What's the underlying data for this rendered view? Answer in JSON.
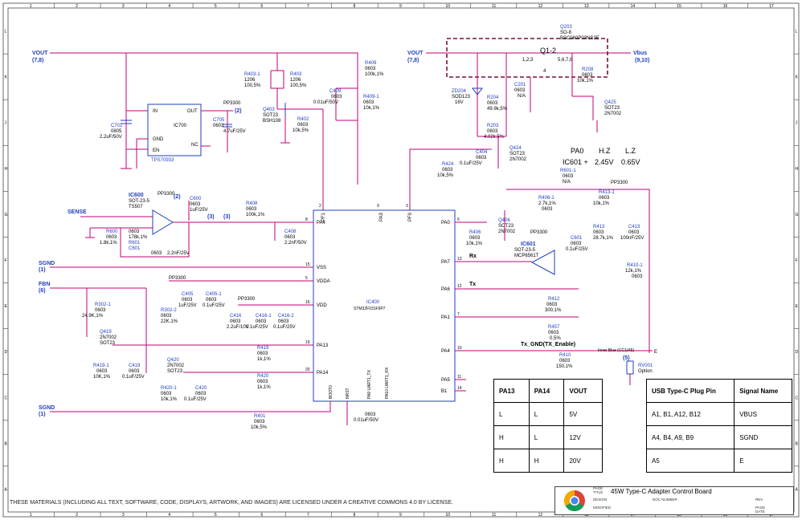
{
  "grid": {
    "columns": [
      "1",
      "2",
      "3",
      "4",
      "5",
      "6",
      "7",
      "8",
      "9",
      "10",
      "11",
      "12",
      "13",
      "14",
      "15",
      "16",
      "17"
    ],
    "rows": [
      "L",
      "K",
      "J",
      "H",
      "G",
      "F",
      "E",
      "D",
      "C",
      "B",
      "A"
    ]
  },
  "nets": {
    "vout_left": "VOUT",
    "vout_left_ref": "(7,8)",
    "vout_right": "VOUT",
    "vout_right_ref": "(7,8)",
    "vbus": "Vbus",
    "vbus_ref": "(9,10)",
    "sense": "SENSE",
    "sgnd_top": "SGND",
    "sgnd_top_ref": "(1)",
    "fbn": "FBN",
    "fbn_ref": "(6)",
    "sgnd_bot": "SGND",
    "sgnd_bot_ref": "(1)",
    "pp3300": "PP3300",
    "ref2": "(2)",
    "ref3a": "(3)",
    "ref3b": "(3)",
    "ref5": "(5)",
    "rx": "Rx",
    "tx": "Tx",
    "tx_gnd": "Tx_GND(TX_Enable)",
    "cc": "Inner Blue (CC1/A5)",
    "e": "E"
  },
  "components": {
    "c701": [
      "C701",
      "0805",
      "2.2uF/50V"
    ],
    "ic700": [
      "IC700",
      "TPS70933",
      "IN",
      "OUT",
      "GND",
      "NC",
      "EN",
      "1",
      "2",
      "3",
      "4",
      "5"
    ],
    "c705": [
      "C705",
      "0603",
      "4.7uF/25V"
    ],
    "r403_1": [
      "R403-1",
      "1206",
      "100,5%"
    ],
    "r403": [
      "R403",
      "1206",
      "100,5%"
    ],
    "q403": [
      "Q403",
      "SOT23",
      "BSH108"
    ],
    "r402": [
      "R402",
      "0603",
      "10k,5%"
    ],
    "c409": [
      "C409",
      "0603",
      "0.01uF/50V"
    ],
    "r409": [
      "R409",
      "0603",
      "100k,1%"
    ],
    "r409_1": [
      "R409-1",
      "0603",
      "10k,1%"
    ],
    "ic600": [
      "IC600",
      "SOT-23-5",
      "TS507"
    ],
    "c600": [
      "C600",
      "0603",
      "1uF/25V"
    ],
    "r600": [
      "R600",
      "0603",
      "1.8k,1%"
    ],
    "r601": [
      "R601",
      "0603",
      "178k,1%"
    ],
    "c601": [
      "C601",
      "0603",
      "2.2nF/25V"
    ],
    "r408": [
      "R408",
      "0603",
      "100k,1%"
    ],
    "c408": [
      "C408",
      "0603",
      "2.2nF/50V"
    ],
    "c405": [
      "C405",
      "0603",
      "1uF/25V"
    ],
    "c405_1": [
      "C405-1",
      "0603",
      "0.1uF/25V"
    ],
    "c416": [
      "C416",
      "0603",
      "2.2uF/10V"
    ],
    "c416_1": [
      "C416-1",
      "0603",
      "0.1uF/25V"
    ],
    "c416_2": [
      "C416-2",
      "0603",
      "0.1uF/25V"
    ],
    "r302_1": [
      "R302-1",
      "0603",
      "24.9K,1%"
    ],
    "r302_2": [
      "R302-2",
      "0603",
      "22K,1%"
    ],
    "q419": [
      "Q419",
      "2N7002",
      "SOT23"
    ],
    "r419_1": [
      "R419-1",
      "0603",
      "10K,1%"
    ],
    "c419": [
      "C419",
      "0603",
      "0.1uF/25V"
    ],
    "q420": [
      "Q420",
      "2N7002",
      "SOT23"
    ],
    "r420_1": [
      "R420-1",
      "0603",
      "10k,1%"
    ],
    "c420": [
      "C420",
      "0603",
      "0.1uF/25V"
    ],
    "r419": [
      "R419",
      "0603",
      "1k,1%"
    ],
    "r420": [
      "R420",
      "0603",
      "1k,1%"
    ],
    "r401": [
      "R401",
      "0603",
      "10k,5%"
    ],
    "c_nrst": [
      "0603",
      "0.01uF/50V"
    ],
    "ic400": [
      "IC400",
      "STM32F031F6P7"
    ],
    "q203": [
      "Q203",
      "SO-8",
      "BSC060P03NS3E"
    ],
    "q1": [
      "Q1-2",
      "1,2,3",
      "5,6,7,8",
      "4"
    ],
    "zd204": [
      "ZD204",
      "SOD123",
      "16V"
    ],
    "r204": [
      "R204",
      "0603",
      "49.9k,5%"
    ],
    "c201": [
      "C201",
      "0603",
      "N/A"
    ],
    "r203": [
      "R203",
      "0603",
      "4.02k,5%"
    ],
    "c404": [
      "C404",
      "0603",
      "0.1uF/25V"
    ],
    "q424": [
      "Q424",
      "SOT23",
      "2N7002"
    ],
    "r424": [
      "R424",
      "0603",
      "10k,5%"
    ],
    "r208": [
      "R208",
      "0603",
      "10k,1%"
    ],
    "q425": [
      "Q425",
      "SOT23",
      "2N7002"
    ],
    "r601_1": [
      "R601-1",
      "0603",
      "N/A"
    ],
    "r406_1": [
      "R406-1",
      "2.7k,1%",
      "0603"
    ],
    "r413_1": [
      "R413-1",
      "0603",
      "10k,1%"
    ],
    "q406": [
      "Q406",
      "SOT23",
      "2N7002"
    ],
    "r406": [
      "R406",
      "0603",
      "10k,1%"
    ],
    "ic601": [
      "IC601",
      "SOT-23-5",
      "MCP6561T"
    ],
    "c601b": [
      "C601",
      "0603",
      "0.1uF/25V"
    ],
    "r413": [
      "R413",
      "0603",
      "28.7k,1%"
    ],
    "c413": [
      "C413",
      "0603",
      "100nF/25V"
    ],
    "r410_1": [
      "R410-1",
      "12k,1%",
      "0603"
    ],
    "r412": [
      "R412",
      "0603",
      "300,1%"
    ],
    "r457": [
      "R457",
      "0603",
      "0,5%"
    ],
    "r410": [
      "R410",
      "0603",
      "150,1%"
    ],
    "rv001": [
      "RV001",
      "Option"
    ]
  },
  "mcu_pins": {
    "left": [
      {
        "num": "8",
        "name": "PA4"
      },
      {
        "num": "15",
        "name": "VSS"
      },
      {
        "num": "5",
        "name": "VDDA"
      },
      {
        "num": "16",
        "name": "VDD"
      },
      {
        "num": "19",
        "name": "PA13"
      },
      {
        "num": "20",
        "name": "PA14"
      }
    ],
    "top": [
      {
        "num": "2",
        "name": "PF1"
      },
      {
        "num": "9",
        "name": "PA3"
      },
      {
        "num": "3",
        "name": "PF0"
      }
    ],
    "right": [
      {
        "num": "6",
        "name": "PA0"
      },
      {
        "num": "13",
        "name": "PA7"
      },
      {
        "num": "12",
        "name": "PA6"
      },
      {
        "num": "7",
        "name": "PA1"
      },
      {
        "num": "10",
        "name": "PA4"
      },
      {
        "num": "11",
        "name": "PA5"
      },
      {
        "num": "14",
        "name": "B1"
      }
    ],
    "bottom": [
      "BOOT0",
      "NRST",
      "PA9 UART1_TX",
      "PA10 UART1_RX"
    ]
  },
  "voltage_note": {
    "h1": "PA0",
    "h2": "H.Z",
    "h3": "L.Z",
    "r1": "IC601 +",
    "r2": "2.45V",
    "r3": "0.65V"
  },
  "pin_table": {
    "headers": [
      "PA13",
      "PA14",
      "VOUT"
    ],
    "rows": [
      [
        "L",
        "L",
        "5V"
      ],
      [
        "H",
        "L",
        "12V"
      ],
      [
        "H",
        "H",
        "20V"
      ]
    ]
  },
  "usb_table": {
    "headers": [
      "USB Type-C Plug Pin",
      "Signal Name"
    ],
    "rows": [
      [
        "A1, B1, A12, B12",
        "VBUS"
      ],
      [
        "A4, B4, A9, B9",
        "SGND"
      ],
      [
        "A5",
        "E"
      ]
    ]
  },
  "footer": "THESE MATERIALS (INCLUDING ALL TEXT, SOFTWARE, CODE, DISPLAYS, ARTWORK, AND IMAGES) ARE LICENSED UNDER A CREATIVE COMMONS 4.0 BY LICENSE.",
  "title_block": {
    "page": "PAGE",
    "title_label": "TITLE",
    "title": "45W Type-C Adapter Control Board",
    "design": "DESIGN",
    "doc_number": "DOC NUMBER",
    "rev": "REV",
    "modified": "MODIFIED",
    "page2": "PAGE",
    "date": "DATE"
  },
  "colors": {
    "wire": "#c0007a",
    "device": "#1f3fbf",
    "junction": "#c0007a",
    "dashed_box": "#7a1030"
  }
}
